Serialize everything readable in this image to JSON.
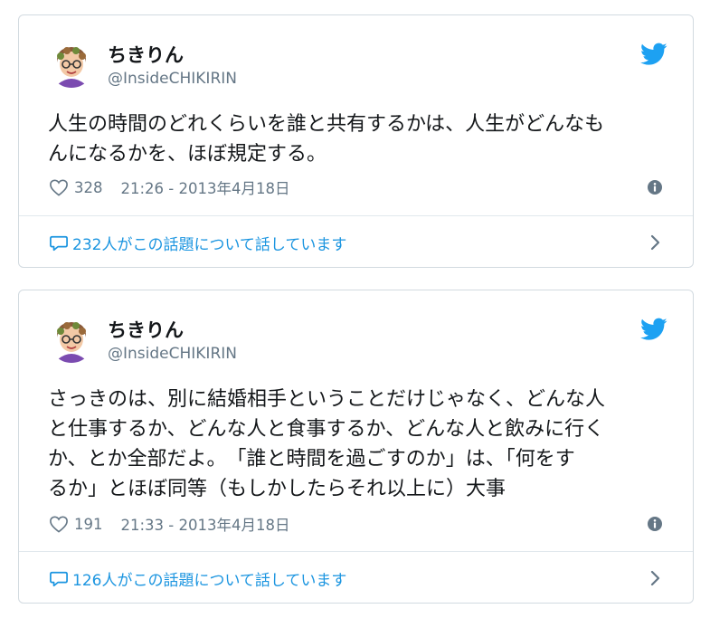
{
  "tweets": [
    {
      "name": "ちきりん",
      "handle": "@InsideCHIKIRIN",
      "lines": [
        "人生の時間のどれくらいを誰と共有するかは、人生がどんなも",
        "んになるかを、ほぼ規定する。"
      ],
      "likes": "328",
      "timestamp": "21:26 - 2013年4月18日",
      "conversation": "232人がこの話題について話しています"
    },
    {
      "name": "ちきりん",
      "handle": "@InsideCHIKIRIN",
      "lines": [
        "さっきのは、別に結婚相手ということだけじゃなく、どんな人",
        "と仕事するか、どんな人と食事するか、どんな人と飲みに行く",
        "か、とか全部だよ。　「誰と時間を過ごすのか」は、「何をす",
        "るか」とほぼ同等（もしかしたらそれ以上に）大事"
      ],
      "likes": "191",
      "timestamp": "21:33 - 2013年4月18日",
      "conversation": "126人がこの話題について話しています"
    }
  ],
  "icons": {
    "brand": "twitter-bird-icon",
    "like": "heart-icon",
    "info": "info-icon",
    "reply": "speech-bubble-icon",
    "more": "chevron-right-icon"
  },
  "colors": {
    "twitter_blue": "#1da1f2",
    "link_blue": "#1b95e0",
    "secondary_text": "#657786",
    "border": "#d2dae0"
  }
}
